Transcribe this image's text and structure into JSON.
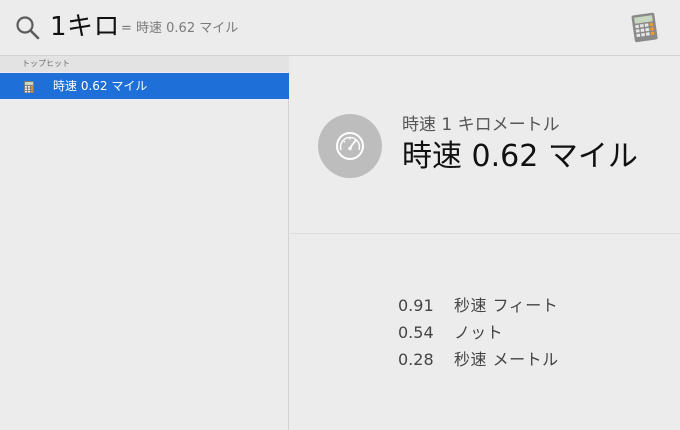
{
  "search": {
    "query": "1キロ",
    "inline_result": "= 時速 0.62 マイル"
  },
  "icons": {
    "search": "magnifying-glass",
    "app": "calculator",
    "preview": "speedometer"
  },
  "results": {
    "section_label": "トップヒット",
    "items": [
      {
        "label": "時速 0.62 マイル",
        "icon": "calculator",
        "selected": true
      }
    ]
  },
  "preview": {
    "subtitle": "時速 1 キロメートル",
    "title": "時速 0.62 マイル",
    "conversions": [
      {
        "value": "0.91",
        "unit": "秒速 フィート"
      },
      {
        "value": "0.54",
        "unit": "ノット"
      },
      {
        "value": "0.28",
        "unit": "秒速 メートル"
      }
    ]
  },
  "colors": {
    "selection": "#1f6fd8",
    "background": "#ececec",
    "gauge": "#bdbdbd"
  }
}
